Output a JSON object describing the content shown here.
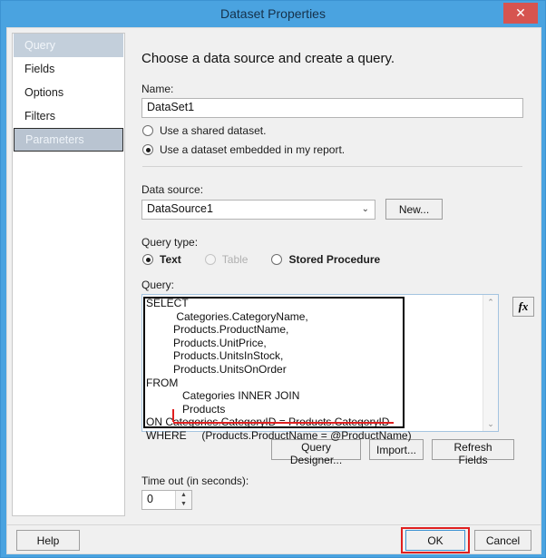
{
  "window": {
    "title": "Dataset Properties",
    "close_glyph": "✕"
  },
  "sidebar": {
    "items": [
      {
        "label": "Query",
        "state": "highlight"
      },
      {
        "label": "Fields",
        "state": "normal"
      },
      {
        "label": "Options",
        "state": "normal"
      },
      {
        "label": "Filters",
        "state": "normal"
      },
      {
        "label": "Parameters",
        "state": "selected"
      }
    ]
  },
  "main": {
    "heading": "Choose a data source and create a query.",
    "name_label": "Name:",
    "name_value": "DataSet1",
    "radio_shared": "Use a shared dataset.",
    "radio_embedded": "Use a dataset embedded in my report.",
    "datasource_label": "Data source:",
    "datasource_value": "DataSource1",
    "new_button": "New...",
    "querytype_label": "Query type:",
    "qt_text": "Text",
    "qt_table": "Table",
    "qt_sproc": "Stored Procedure",
    "query_label": "Query:",
    "fx_button": "fx",
    "query_text": "SELECT\n          Categories.CategoryName,\n         Products.ProductName,\n         Products.UnitPrice,\n         Products.UnitsInStock,\n         Products.UnitsOnOrder\nFROM\n            Categories INNER JOIN\n            Products\nON Categories.CategoryID = Products.CategoryID\nWHERE     (Products.ProductName = @ProductName)",
    "scroll_up_glyph": "⌃",
    "scroll_down_glyph": "⌄",
    "btn_query_designer": "Query Designer...",
    "btn_import": "Import...",
    "btn_refresh_fields": "Refresh Fields",
    "timeout_label": "Time out (in seconds):",
    "timeout_value": "0",
    "spin_up_glyph": "▲",
    "spin_down_glyph": "▼",
    "combo_chevron": "⌄"
  },
  "footer": {
    "help": "Help",
    "ok": "OK",
    "cancel": "Cancel"
  },
  "colors": {
    "titlebar": "#4aa3e0",
    "close": "#d65450",
    "annotation_red": "#e02020",
    "annotation_black": "#000000",
    "nav_highlight": "#c3cfdb",
    "nav_selected": "#b9c4d1"
  }
}
